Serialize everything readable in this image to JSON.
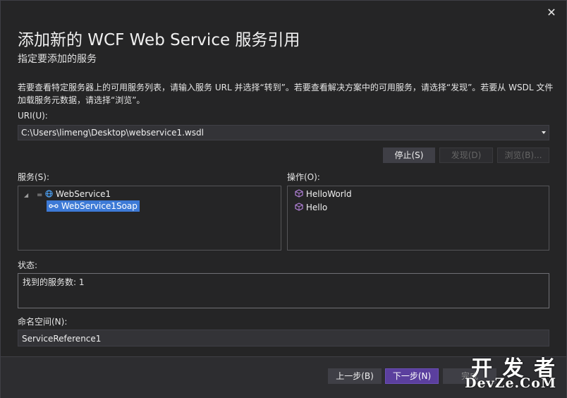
{
  "dialog": {
    "title": "添加新的 WCF Web Service 服务引用",
    "subtitle": "指定要添加的服务",
    "description": "若要查看特定服务器上的可用服务列表，请输入服务 URL 并选择“转到”。若要查看解决方案中的可用服务，请选择“发现”。若要从 WSDL 文件加载服务元数据，请选择“浏览”。",
    "close_glyph": "✕"
  },
  "uri": {
    "label": "URI(U):",
    "value": "C:\\Users\\limeng\\Desktop\\webservice1.wsdl"
  },
  "actions": {
    "stop": "停止(S)",
    "discover": "发现(D)",
    "browse": "浏览(B)..."
  },
  "services": {
    "label": "服务(S):",
    "tree": [
      {
        "label": "WebService1",
        "icon": "globe-icon"
      },
      {
        "label": "WebService1Soap",
        "icon": "endpoint-icon"
      }
    ]
  },
  "operations": {
    "label": "操作(O):",
    "items": [
      {
        "label": "HelloWorld",
        "icon": "cube-icon"
      },
      {
        "label": "Hello",
        "icon": "cube-icon"
      }
    ]
  },
  "status": {
    "label": "状态:",
    "text": "找到的服务数: 1"
  },
  "namespace": {
    "label": "命名空间(N):",
    "value": "ServiceReference1"
  },
  "footer": {
    "prev": "上一步(B)",
    "next": "下一步(N)",
    "finish": "完成"
  },
  "watermark": {
    "line1": "开 发 者",
    "line2": "DevZe.CoM"
  }
}
